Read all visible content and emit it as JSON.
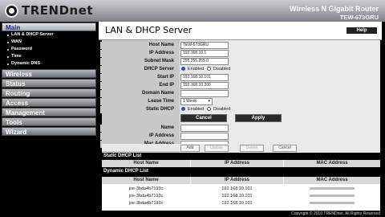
{
  "brand": {
    "name": "TRENDnet"
  },
  "product": {
    "title": "Wireless N Gigabit Router",
    "model": "TEW-673GRU"
  },
  "sidebar": {
    "main_label": "Main",
    "main_items": [
      "LAN & DHCP Server",
      "WAN",
      "Password",
      "Time",
      "Dynamic DNS"
    ],
    "sections": [
      "Wireless",
      "Status",
      "Routing",
      "Access",
      "Management",
      "Tools",
      "Wizard"
    ]
  },
  "page": {
    "title": "LAN & DHCP Server",
    "help_label": "Help"
  },
  "form": {
    "host_name_label": "Host Name",
    "host_name_value": "TEW-673GRU",
    "ip_label": "IP Address",
    "ip_value": "192.168.10.1",
    "mask_label": "Subnet Mask",
    "mask_value": "255.255.255.0",
    "dhcp_label": "DHCP Server",
    "enabled_label": "Enabled",
    "disabled_label": "Disabled",
    "start_label": "Start IP",
    "start_value": "192.168.10.101",
    "end_label": "End IP",
    "end_value": "192.168.10.200",
    "domain_label": "Domain Name",
    "domain_value": "",
    "lease_label": "Lease Time",
    "lease_value": "1 Week",
    "static_label": "Static DHCP",
    "cancel_label": "Cancel",
    "apply_label": "Apply",
    "name_label": "Name",
    "ip2_label": "IP Address",
    "mac_label": "Mac Address",
    "add_label": "Add",
    "update_label": "Update",
    "delete_label": "Delete",
    "cancel2_label": "Cancel"
  },
  "static_list": {
    "title": "Static DHCP List",
    "headers": [
      "Host Name",
      "IP Address",
      "MAC Address"
    ]
  },
  "dynamic_list": {
    "title": "Dynamic DHCP List",
    "headers": [
      "Host Name",
      "IP Address",
      "MAC Address"
    ],
    "rows": [
      {
        "host": "joe-3bda4b7193c",
        "ip": "192.168.10.101"
      },
      {
        "host": "joe-3bda4b7193c",
        "ip": "192.168.10.101"
      },
      {
        "host": "joe-3bda4b7193c",
        "ip": "192.168.10.101"
      }
    ]
  },
  "footer": {
    "text": "Copyright © 2010 TRENDnet. All Rights Reserved"
  }
}
